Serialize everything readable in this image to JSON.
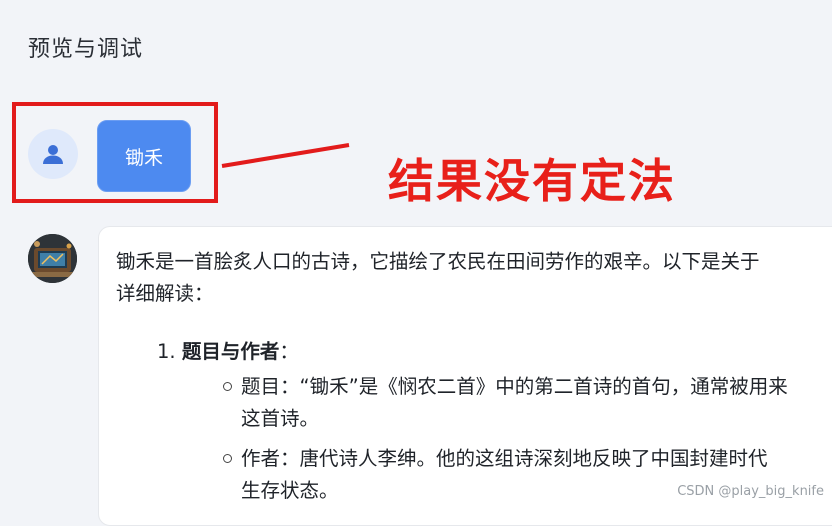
{
  "panel": {
    "title": "预览与调试"
  },
  "user_message": {
    "text": "锄禾"
  },
  "annotation": {
    "text": "结果没有定法"
  },
  "assistant_message": {
    "intro_line1": "锄禾是一首脍炙人口的古诗，它描绘了农民在田间劳作的艰辛。以下是关于",
    "intro_line2": "详细解读：",
    "list": [
      {
        "number": "1.",
        "heading": "题目与作者",
        "heading_suffix": "：",
        "sub": [
          {
            "line1": "题目：“锄禾”是《悯农二首》中的第二首诗的首句，通常被用来",
            "line2": "这首诗。"
          },
          {
            "line1": "作者：唐代诗人李绅。他的这组诗深刻地反映了中国封建时代",
            "line2": "生存状态。"
          }
        ]
      }
    ]
  },
  "watermark": "CSDN @play_big_knife",
  "colors": {
    "bubble": "#4d8af0",
    "annotation_red": "#e21b1b",
    "background": "#f2f4f8"
  }
}
